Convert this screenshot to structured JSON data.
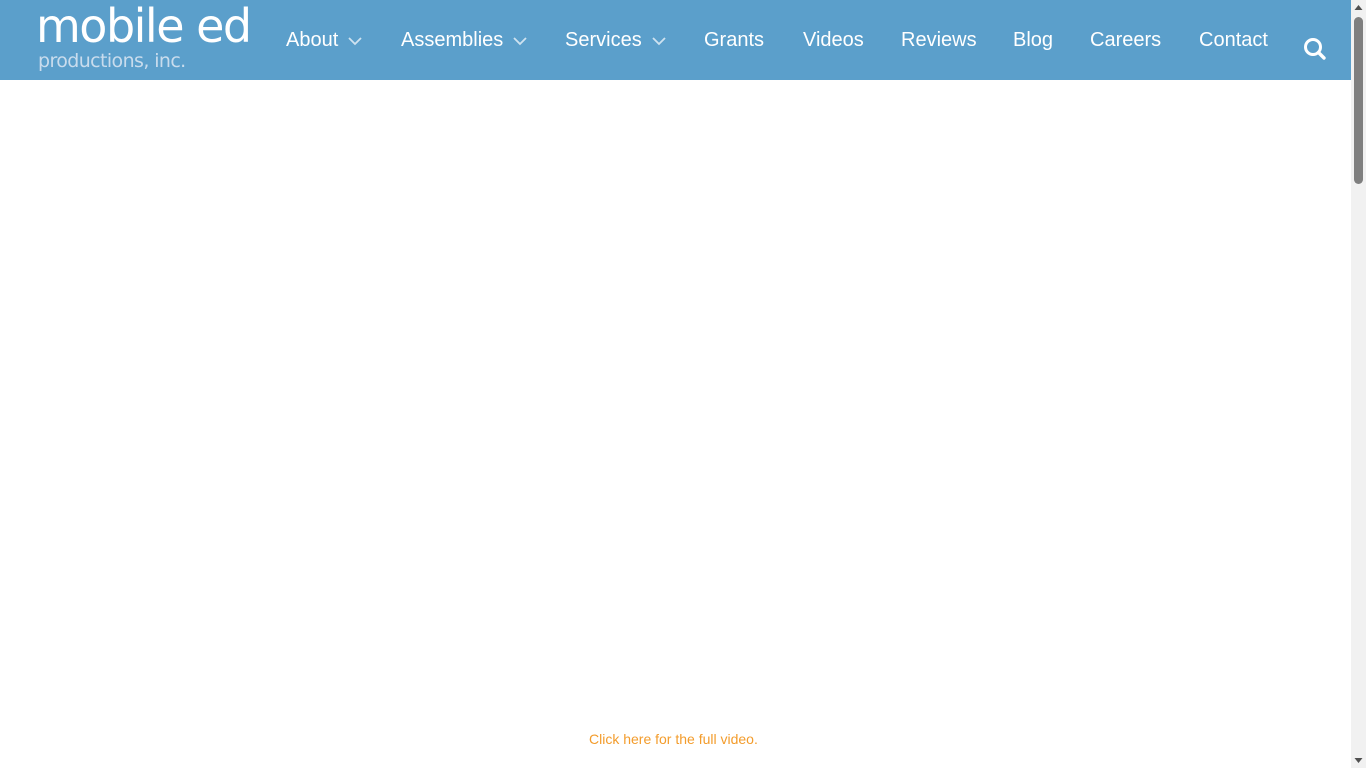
{
  "brand": {
    "name": "mobile ed",
    "tagline": "productions, inc.",
    "header_color": "#5b9fcb"
  },
  "nav": {
    "items": [
      {
        "label": "About",
        "has_dropdown": true
      },
      {
        "label": "Assemblies",
        "has_dropdown": true
      },
      {
        "label": "Services",
        "has_dropdown": true
      },
      {
        "label": "Grants",
        "has_dropdown": false
      },
      {
        "label": "Videos",
        "has_dropdown": false
      },
      {
        "label": "Reviews",
        "has_dropdown": false
      },
      {
        "label": "Blog",
        "has_dropdown": false
      },
      {
        "label": "Careers",
        "has_dropdown": false
      },
      {
        "label": "Contact",
        "has_dropdown": false
      }
    ],
    "dropdown_icon": "chevron-down-icon",
    "search_icon": "search-icon"
  },
  "main": {
    "video_link_text": "Click here for the full video.",
    "link_color": "#f39c2c"
  },
  "scrollbar": {
    "up_icon": "arrow-up-icon",
    "down_icon": "arrow-down-icon"
  }
}
